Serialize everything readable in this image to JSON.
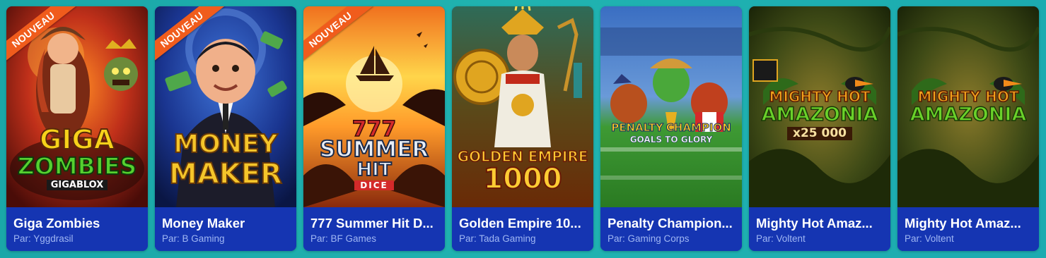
{
  "provider_prefix": "Par:",
  "games": [
    {
      "title": "Giga Zombies",
      "provider": "Par: Yggdrasil",
      "badge": "NOUVEAU",
      "logo_lines": [
        "GIGA",
        "ZOMBIES",
        "GIGABLOX"
      ],
      "colors": {
        "bg_top": "#d4421a",
        "bg_bottom": "#5a0e0a",
        "logo": "#f7d21a",
        "logo2": "#55d12f"
      }
    },
    {
      "title": "Money Maker",
      "provider": "Par: B Gaming",
      "badge": "NOUVEAU",
      "logo_lines": [
        "MONEY",
        "MAKER"
      ],
      "colors": {
        "bg_top": "#2a55b8",
        "bg_bottom": "#0c1a4e",
        "logo": "#f5c52a"
      }
    },
    {
      "title": "777 Summer Hit D...",
      "provider": "Par: BF Games",
      "badge": "NOUVEAU",
      "logo_lines": [
        "777",
        "SUMMER",
        "HIT",
        "DICE"
      ],
      "colors": {
        "bg_top": "#ffd34a",
        "bg_bottom": "#c13a12",
        "logo": "#e8eef6"
      }
    },
    {
      "title": "Golden Empire 10...",
      "provider": "Par: Tada Gaming",
      "badge": "",
      "logo_lines": [
        "GOLDEN EMPIRE",
        "1000"
      ],
      "colors": {
        "bg_top": "#2f6e5a",
        "bg_bottom": "#7a3a08",
        "logo": "#ffcc33"
      }
    },
    {
      "title": "Penalty Champion...",
      "provider": "Par: Gaming Corps",
      "badge": "",
      "logo_lines": [
        "PENALTY",
        "CHAMPION",
        "GOALS TO GLORY"
      ],
      "colors": {
        "bg_top": "#3a6ec2",
        "bg_bottom": "#2f8a2a",
        "logo": "#ffd21a"
      }
    },
    {
      "title": "Mighty Hot Amaz...",
      "provider": "Par: Voltent",
      "badge": "",
      "logo_lines": [
        "MIGHTY HOT",
        "AMAZONIA",
        "x25 000"
      ],
      "colors": {
        "bg_top": "#3c4a14",
        "bg_bottom": "#1e2a08",
        "logo": "#f0a21a"
      }
    },
    {
      "title": "Mighty Hot Amaz...",
      "provider": "Par: Voltent",
      "badge": "",
      "logo_lines": [
        "MIGHTY HOT",
        "AMAZONIA"
      ],
      "colors": {
        "bg_top": "#3c4a14",
        "bg_bottom": "#1e2a08",
        "logo": "#f0a21a"
      }
    }
  ]
}
